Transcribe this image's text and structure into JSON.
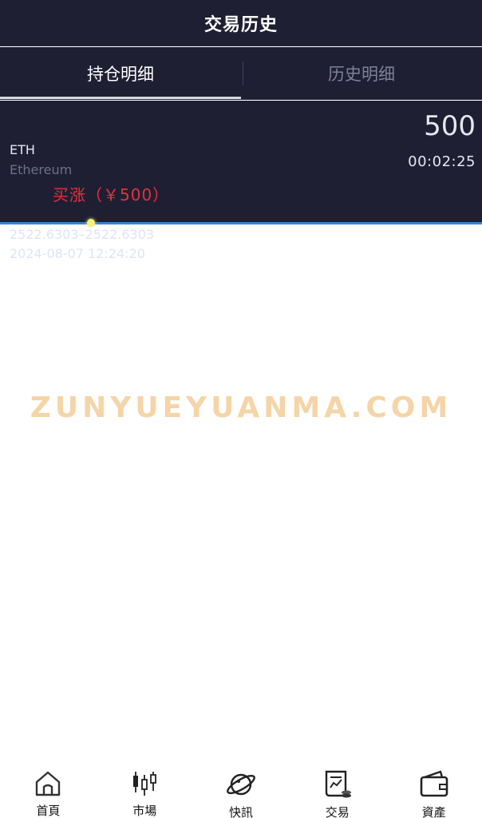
{
  "header": {
    "title": "交易历史"
  },
  "tabs": [
    {
      "label": "持仓明细",
      "active": true
    },
    {
      "label": "历史明细",
      "active": false
    }
  ],
  "position": {
    "symbol": "ETH",
    "name": "Ethereum",
    "order": "买涨（￥500）",
    "amount": "500",
    "countdown": "00:02:25",
    "price_range": "2522.6303–2522.6303",
    "time": "2024-08-07 12:24:20"
  },
  "watermark": "ZUNYUEYUANMA.COM",
  "bottom_nav": [
    {
      "label": "首頁",
      "icon": "home-icon"
    },
    {
      "label": "市場",
      "icon": "candlestick-icon"
    },
    {
      "label": "快訊",
      "icon": "planet-icon"
    },
    {
      "label": "交易",
      "icon": "trade-document-icon"
    },
    {
      "label": "資產",
      "icon": "wallet-icon"
    }
  ],
  "colors": {
    "dark_bg": "#1f1f33",
    "accent_line": "#2f86d6",
    "buy_red": "#e2333c",
    "watermark": "#f5d4a8"
  }
}
